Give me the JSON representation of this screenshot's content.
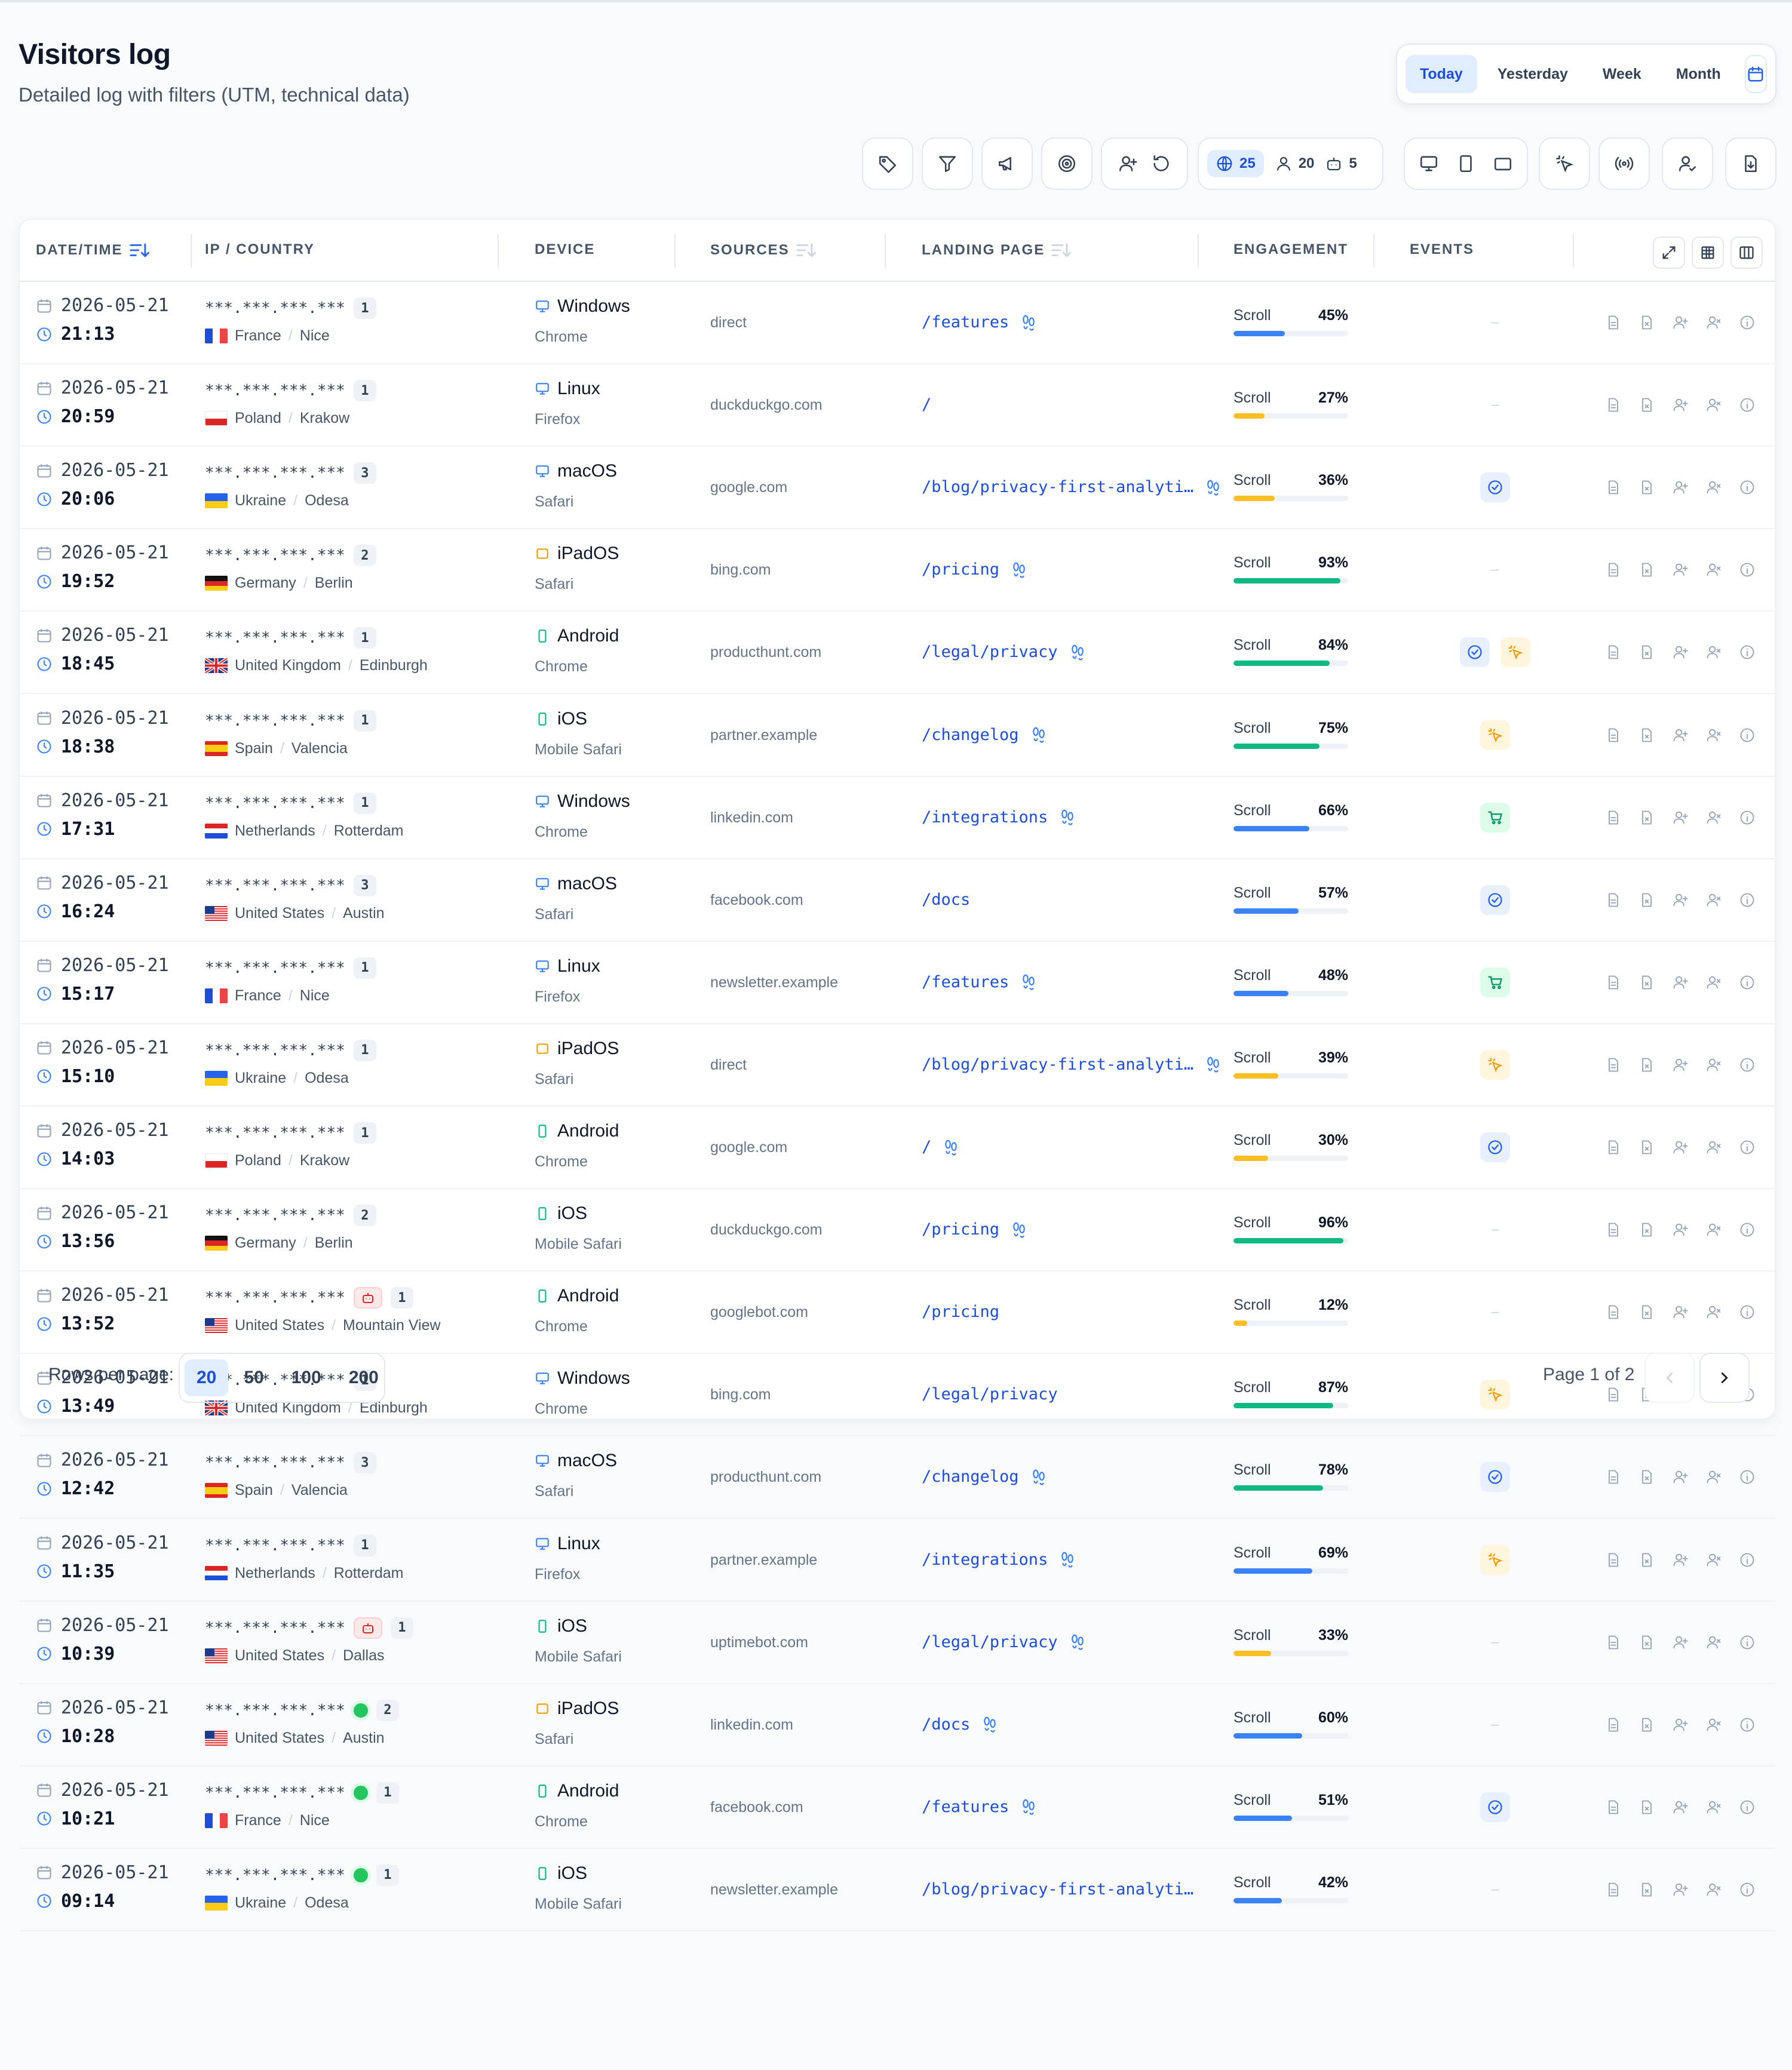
{
  "header": {
    "title": "Visitors log",
    "subtitle": "Detailed log with filters (UTM, technical data)"
  },
  "date_range": {
    "options": [
      "Today",
      "Yesterday",
      "Week",
      "Month"
    ],
    "selected": "Today",
    "calendar_icon": "calendar-icon"
  },
  "toolbar": {
    "counts": {
      "all": "25",
      "visitors": "20",
      "bots": "5"
    },
    "icons": [
      "tag-icon",
      "filter-icon",
      "megaphone-icon",
      "target-icon",
      "user-plus-icon",
      "refresh-icon",
      "globe-icon",
      "user-icon",
      "bot-icon",
      "desktop-icon",
      "tablet-icon",
      "window-icon",
      "click-icon",
      "broadcast-icon",
      "user-check-icon",
      "export-icon"
    ]
  },
  "table": {
    "columns": {
      "datetime": "DATE/TIME",
      "ip": "IP / COUNTRY",
      "device": "DEVICE",
      "sources": "SOURCES",
      "landing": "LANDING PAGE",
      "engagement": "ENGAGEMENT",
      "events": "EVENTS"
    },
    "engagement_label": "Scroll",
    "rows": [
      {
        "date": "2026-05-21",
        "time": "21:13",
        "ip": "***.***.***.***",
        "count": "1",
        "bot": false,
        "online": false,
        "country": "France",
        "city": "Nice",
        "flag": "fr",
        "os": "Windows",
        "os_kind": "desktop",
        "browser": "Chrome",
        "source": "direct",
        "page": "/features",
        "steps": true,
        "scroll": 45,
        "scroll_label": "45%",
        "events": []
      },
      {
        "date": "2026-05-21",
        "time": "20:59",
        "ip": "***.***.***.***",
        "count": "1",
        "bot": false,
        "online": false,
        "country": "Poland",
        "city": "Krakow",
        "flag": "pl",
        "os": "Linux",
        "os_kind": "desktop",
        "browser": "Firefox",
        "source": "duckduckgo.com",
        "page": "/",
        "steps": false,
        "scroll": 27,
        "scroll_label": "27%",
        "events": []
      },
      {
        "date": "2026-05-21",
        "time": "20:06",
        "ip": "***.***.***.***",
        "count": "3",
        "bot": false,
        "online": false,
        "country": "Ukraine",
        "city": "Odesa",
        "flag": "ua",
        "os": "macOS",
        "os_kind": "desktop",
        "browser": "Safari",
        "source": "google.com",
        "page": "/blog/privacy-first-analyti…",
        "steps": true,
        "scroll": 36,
        "scroll_label": "36%",
        "events": [
          "goal"
        ]
      },
      {
        "date": "2026-05-21",
        "time": "19:52",
        "ip": "***.***.***.***",
        "count": "2",
        "bot": false,
        "online": false,
        "country": "Germany",
        "city": "Berlin",
        "flag": "de",
        "os": "iPadOS",
        "os_kind": "tablet",
        "browser": "Safari",
        "source": "bing.com",
        "page": "/pricing",
        "steps": true,
        "scroll": 93,
        "scroll_label": "93%",
        "events": []
      },
      {
        "date": "2026-05-21",
        "time": "18:45",
        "ip": "***.***.***.***",
        "count": "1",
        "bot": false,
        "online": false,
        "country": "United Kingdom",
        "city": "Edinburgh",
        "flag": "gb",
        "os": "Android",
        "os_kind": "mobile",
        "browser": "Chrome",
        "source": "producthunt.com",
        "page": "/legal/privacy",
        "steps": true,
        "scroll": 84,
        "scroll_label": "84%",
        "events": [
          "goal",
          "click"
        ]
      },
      {
        "date": "2026-05-21",
        "time": "18:38",
        "ip": "***.***.***.***",
        "count": "1",
        "bot": false,
        "online": false,
        "country": "Spain",
        "city": "Valencia",
        "flag": "es",
        "os": "iOS",
        "os_kind": "mobile",
        "browser": "Mobile Safari",
        "source": "partner.example",
        "page": "/changelog",
        "steps": true,
        "scroll": 75,
        "scroll_label": "75%",
        "events": [
          "click"
        ]
      },
      {
        "date": "2026-05-21",
        "time": "17:31",
        "ip": "***.***.***.***",
        "count": "1",
        "bot": false,
        "online": false,
        "country": "Netherlands",
        "city": "Rotterdam",
        "flag": "nl",
        "os": "Windows",
        "os_kind": "desktop",
        "browser": "Chrome",
        "source": "linkedin.com",
        "page": "/integrations",
        "steps": true,
        "scroll": 66,
        "scroll_label": "66%",
        "events": [
          "cart"
        ]
      },
      {
        "date": "2026-05-21",
        "time": "16:24",
        "ip": "***.***.***.***",
        "count": "3",
        "bot": false,
        "online": false,
        "country": "United States",
        "city": "Austin",
        "flag": "us",
        "os": "macOS",
        "os_kind": "desktop",
        "browser": "Safari",
        "source": "facebook.com",
        "page": "/docs",
        "steps": false,
        "scroll": 57,
        "scroll_label": "57%",
        "events": [
          "goal"
        ]
      },
      {
        "date": "2026-05-21",
        "time": "15:17",
        "ip": "***.***.***.***",
        "count": "1",
        "bot": false,
        "online": false,
        "country": "France",
        "city": "Nice",
        "flag": "fr",
        "os": "Linux",
        "os_kind": "desktop",
        "browser": "Firefox",
        "source": "newsletter.example",
        "page": "/features",
        "steps": true,
        "scroll": 48,
        "scroll_label": "48%",
        "events": [
          "cart"
        ]
      },
      {
        "date": "2026-05-21",
        "time": "15:10",
        "ip": "***.***.***.***",
        "count": "1",
        "bot": false,
        "online": false,
        "country": "Ukraine",
        "city": "Odesa",
        "flag": "ua",
        "os": "iPadOS",
        "os_kind": "tablet",
        "browser": "Safari",
        "source": "direct",
        "page": "/blog/privacy-first-analyti…",
        "steps": true,
        "scroll": 39,
        "scroll_label": "39%",
        "events": [
          "click"
        ]
      },
      {
        "date": "2026-05-21",
        "time": "14:03",
        "ip": "***.***.***.***",
        "count": "1",
        "bot": false,
        "online": false,
        "country": "Poland",
        "city": "Krakow",
        "flag": "pl",
        "os": "Android",
        "os_kind": "mobile",
        "browser": "Chrome",
        "source": "google.com",
        "page": "/",
        "steps": true,
        "scroll": 30,
        "scroll_label": "30%",
        "events": [
          "goal"
        ]
      },
      {
        "date": "2026-05-21",
        "time": "13:56",
        "ip": "***.***.***.***",
        "count": "2",
        "bot": false,
        "online": false,
        "country": "Germany",
        "city": "Berlin",
        "flag": "de",
        "os": "iOS",
        "os_kind": "mobile",
        "browser": "Mobile Safari",
        "source": "duckduckgo.com",
        "page": "/pricing",
        "steps": true,
        "scroll": 96,
        "scroll_label": "96%",
        "events": []
      },
      {
        "date": "2026-05-21",
        "time": "13:52",
        "ip": "***.***.***.***",
        "count": "1",
        "bot": true,
        "online": false,
        "country": "United States",
        "city": "Mountain View",
        "flag": "us",
        "os": "Android",
        "os_kind": "mobile",
        "browser": "Chrome",
        "source": "googlebot.com",
        "page": "/pricing",
        "steps": false,
        "scroll": 12,
        "scroll_label": "12%",
        "events": []
      },
      {
        "date": "2026-05-21",
        "time": "13:49",
        "ip": "***.***.***.***",
        "count": "1",
        "bot": false,
        "online": false,
        "country": "United Kingdom",
        "city": "Edinburgh",
        "flag": "gb",
        "os": "Windows",
        "os_kind": "desktop",
        "browser": "Chrome",
        "source": "bing.com",
        "page": "/legal/privacy",
        "steps": false,
        "scroll": 87,
        "scroll_label": "87%",
        "events": [
          "click"
        ]
      },
      {
        "date": "2026-05-21",
        "time": "12:42",
        "ip": "***.***.***.***",
        "count": "3",
        "bot": false,
        "online": false,
        "country": "Spain",
        "city": "Valencia",
        "flag": "es",
        "os": "macOS",
        "os_kind": "desktop",
        "browser": "Safari",
        "source": "producthunt.com",
        "page": "/changelog",
        "steps": true,
        "scroll": 78,
        "scroll_label": "78%",
        "events": [
          "goal"
        ]
      },
      {
        "date": "2026-05-21",
        "time": "11:35",
        "ip": "***.***.***.***",
        "count": "1",
        "bot": false,
        "online": false,
        "country": "Netherlands",
        "city": "Rotterdam",
        "flag": "nl",
        "os": "Linux",
        "os_kind": "desktop",
        "browser": "Firefox",
        "source": "partner.example",
        "page": "/integrations",
        "steps": true,
        "scroll": 69,
        "scroll_label": "69%",
        "events": [
          "click"
        ]
      },
      {
        "date": "2026-05-21",
        "time": "10:39",
        "ip": "***.***.***.***",
        "count": "1",
        "bot": true,
        "online": false,
        "country": "United States",
        "city": "Dallas",
        "flag": "us",
        "os": "iOS",
        "os_kind": "mobile",
        "browser": "Mobile Safari",
        "source": "uptimebot.com",
        "page": "/legal/privacy",
        "steps": true,
        "scroll": 33,
        "scroll_label": "33%",
        "events": []
      },
      {
        "date": "2026-05-21",
        "time": "10:28",
        "ip": "***.***.***.***",
        "count": "2",
        "bot": false,
        "online": true,
        "country": "United States",
        "city": "Austin",
        "flag": "us",
        "os": "iPadOS",
        "os_kind": "tablet",
        "browser": "Safari",
        "source": "linkedin.com",
        "page": "/docs",
        "steps": true,
        "scroll": 60,
        "scroll_label": "60%",
        "events": []
      },
      {
        "date": "2026-05-21",
        "time": "10:21",
        "ip": "***.***.***.***",
        "count": "1",
        "bot": false,
        "online": true,
        "country": "France",
        "city": "Nice",
        "flag": "fr",
        "os": "Android",
        "os_kind": "mobile",
        "browser": "Chrome",
        "source": "facebook.com",
        "page": "/features",
        "steps": true,
        "scroll": 51,
        "scroll_label": "51%",
        "events": [
          "goal"
        ]
      },
      {
        "date": "2026-05-21",
        "time": "09:14",
        "ip": "***.***.***.***",
        "count": "1",
        "bot": false,
        "online": true,
        "country": "Ukraine",
        "city": "Odesa",
        "flag": "ua",
        "os": "iOS",
        "os_kind": "mobile",
        "browser": "Mobile Safari",
        "source": "newsletter.example",
        "page": "/blog/privacy-first-analyti…",
        "steps": false,
        "scroll": 42,
        "scroll_label": "42%",
        "events": []
      }
    ]
  },
  "pagination": {
    "rows_label": "Rows per page:",
    "options": [
      "20",
      "50",
      "100",
      "200"
    ],
    "selected": "20",
    "page_info": "Page 1 of 2"
  },
  "colors": {
    "accent": "#1d4ed8",
    "bar_blue": "#3b82f6",
    "bar_amber": "#fbbf24",
    "bar_green": "#10b981",
    "bot_red": "#dc2626",
    "online_green": "#22c55e"
  }
}
